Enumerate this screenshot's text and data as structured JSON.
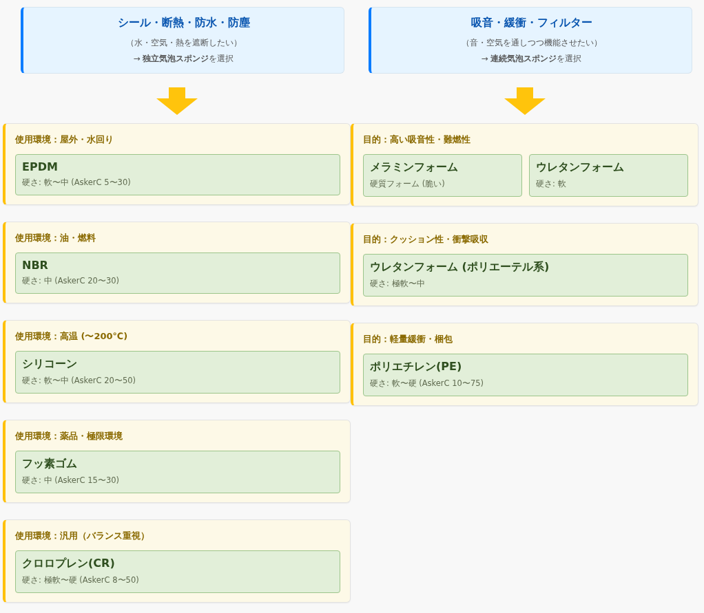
{
  "columns": [
    {
      "header": {
        "title": "シール・断熱・防水・防塵",
        "subtitle": "（水・空気・熱を遮断したい）",
        "conclusion": "→ **独立気泡スポンジ**を選択"
      },
      "groups": [
        {
          "title": "使用環境：屋外・水回り",
          "materials": [
            {
              "name": "EPDM",
              "note": "硬さ: 軟〜中 (AskerC 5〜30)"
            }
          ]
        },
        {
          "title": "使用環境：油・燃料",
          "materials": [
            {
              "name": "NBR",
              "note": "硬さ: 中 (AskerC 20〜30)"
            }
          ]
        },
        {
          "title": "使用環境：高温 (〜200℃)",
          "materials": [
            {
              "name": "シリコーン",
              "note": "硬さ: 軟〜中 (AskerC 20〜50)"
            }
          ]
        },
        {
          "title": "使用環境：薬品・極限環境",
          "materials": [
            {
              "name": "フッ素ゴム",
              "note": "硬さ: 中 (AskerC 15〜30)"
            }
          ]
        },
        {
          "title": "使用環境：汎用（バランス重視）",
          "materials": [
            {
              "name": "クロロプレン(CR)",
              "note": "硬さ: 極軟〜硬 (AskerC 8〜50)"
            }
          ]
        }
      ]
    },
    {
      "header": {
        "title": "吸音・緩衝・フィルター",
        "subtitle": "（音・空気を通しつつ機能させたい）",
        "conclusion": "→ **連続気泡スポンジ**を選択"
      },
      "groups": [
        {
          "title": "目的：高い吸音性・難燃性",
          "materials": [
            {
              "name": "メラミンフォーム",
              "note": "硬質フォーム (脆い)"
            },
            {
              "name": "ウレタンフォーム",
              "note": "硬さ: 軟"
            }
          ]
        },
        {
          "title": "目的：クッション性・衝撃吸収",
          "materials": [
            {
              "name": "ウレタンフォーム (ポリエーテル系)",
              "note": "硬さ: 極軟〜中"
            }
          ]
        },
        {
          "title": "目的：軽量緩衝・梱包",
          "materials": [
            {
              "name": "ポリエチレン(PE)",
              "note": "硬さ: 軟〜硬 (AskerC 10〜75)"
            }
          ]
        }
      ]
    }
  ]
}
